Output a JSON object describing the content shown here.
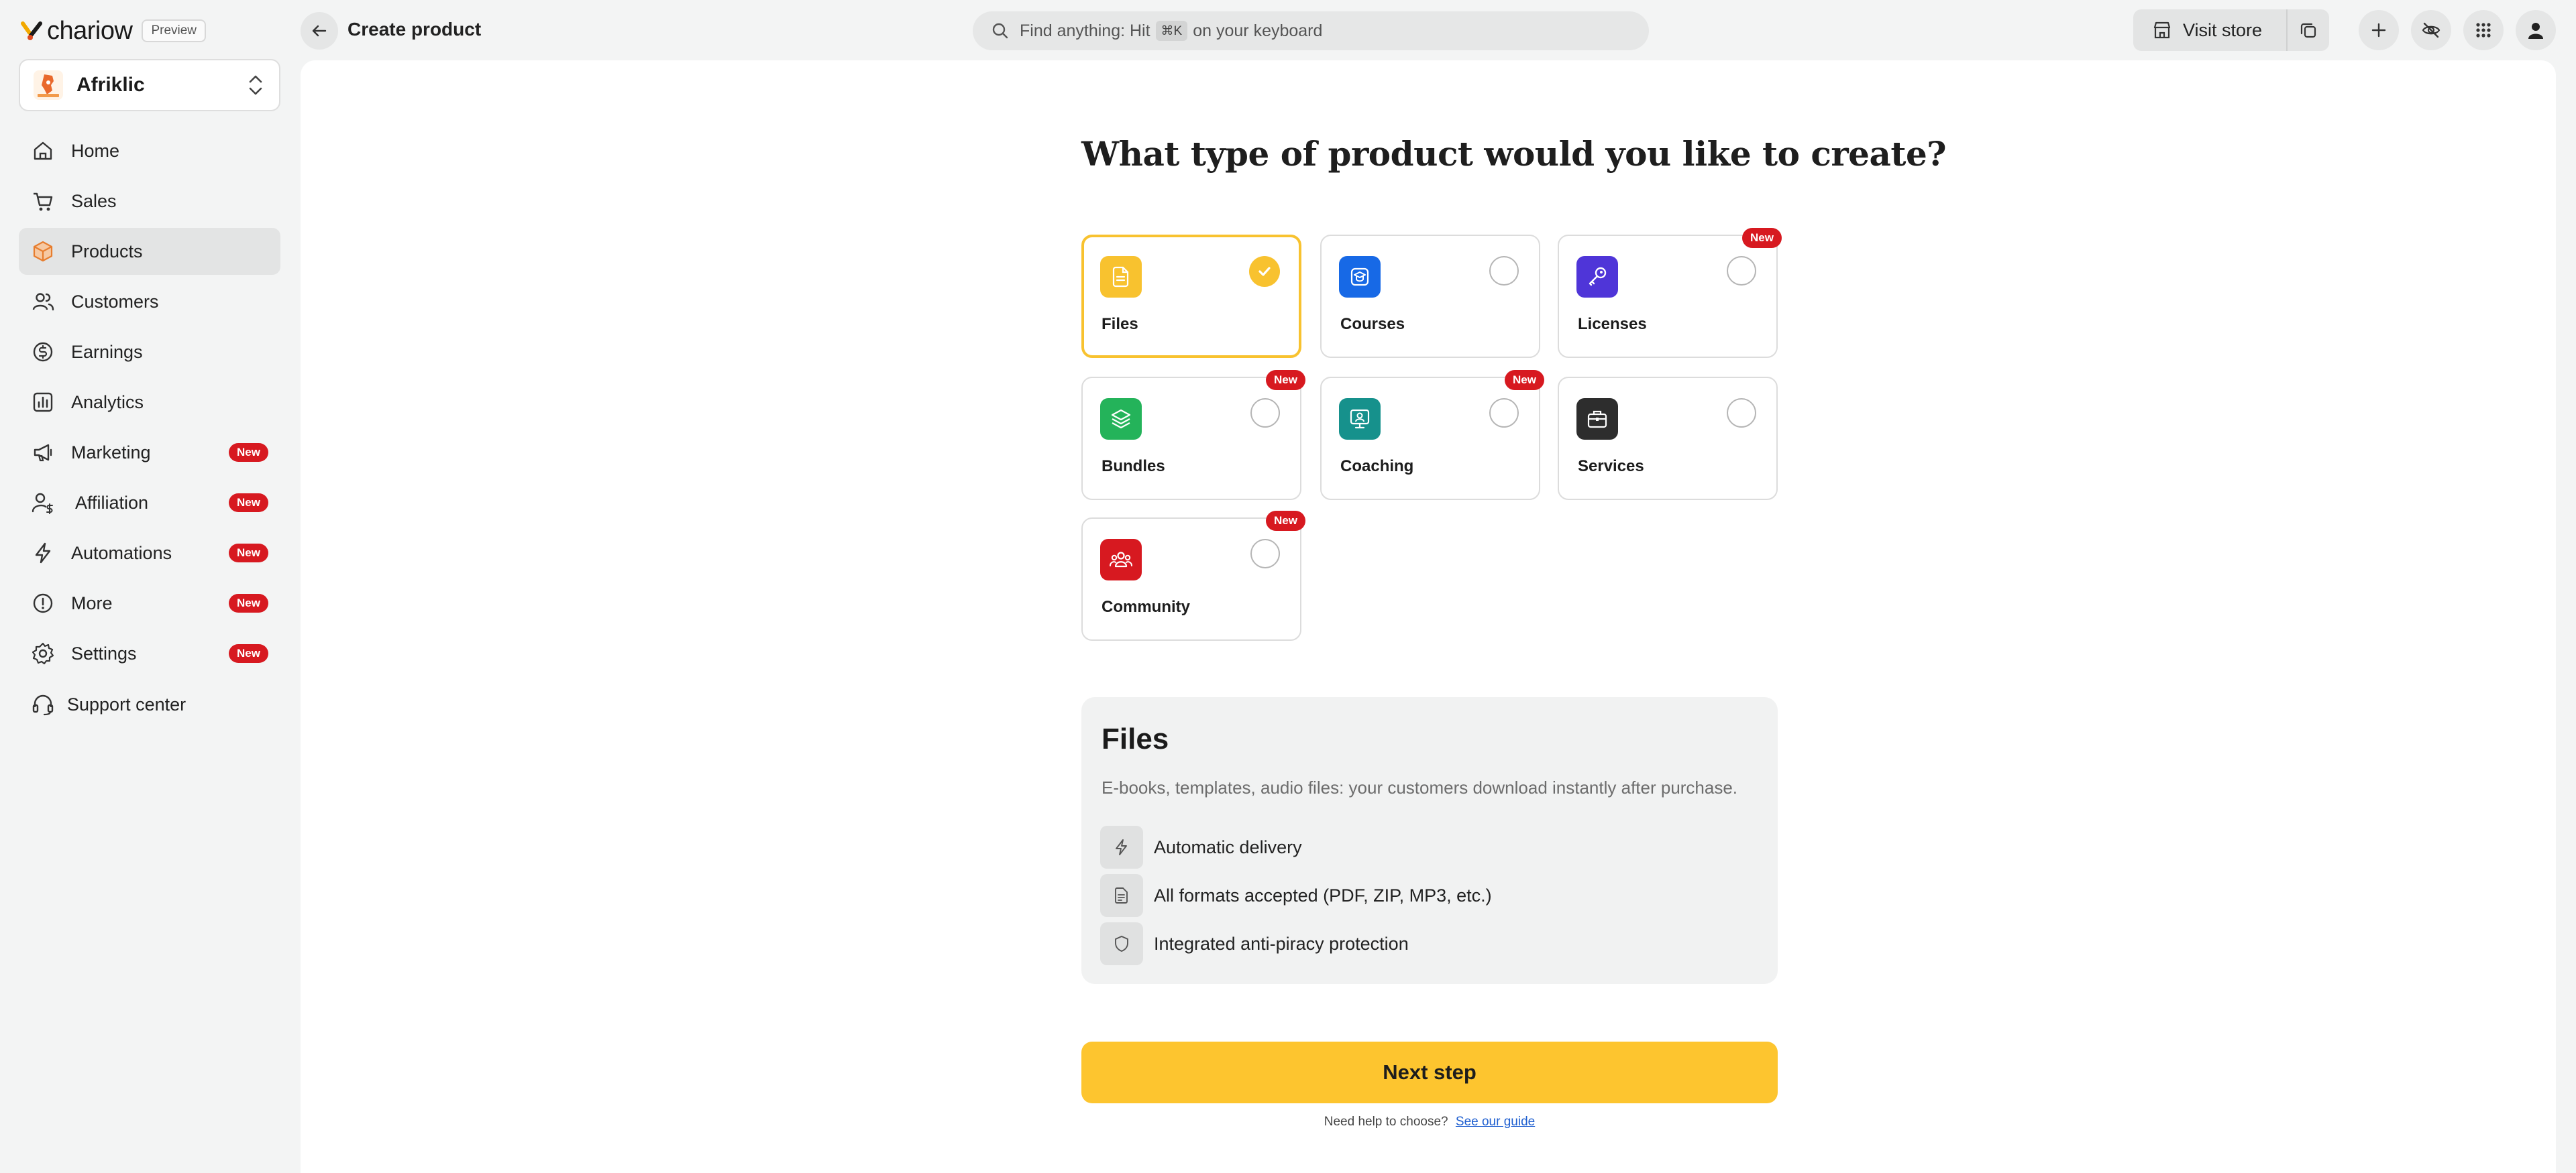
{
  "brand": {
    "name": "chariow",
    "preview_label": "Preview",
    "accent": "#fdc52f"
  },
  "store": {
    "name": "Afriklic",
    "avatar_caption": "Afriklic"
  },
  "nav": {
    "new_badge": "New",
    "items": [
      {
        "label": "Home",
        "icon": "home-icon",
        "new": false,
        "active": false
      },
      {
        "label": "Sales",
        "icon": "cart-icon",
        "new": false,
        "active": false
      },
      {
        "label": "Products",
        "icon": "box-icon",
        "new": false,
        "active": true
      },
      {
        "label": "Customers",
        "icon": "users-icon",
        "new": false,
        "active": false
      },
      {
        "label": "Earnings",
        "icon": "coin-icon",
        "new": false,
        "active": false
      },
      {
        "label": "Analytics",
        "icon": "chart-icon",
        "new": false,
        "active": false
      },
      {
        "label": "Marketing",
        "icon": "megaphone-icon",
        "new": true,
        "active": false
      },
      {
        "label": "Affiliation",
        "icon": "user-dollar-icon",
        "new": true,
        "active": false
      },
      {
        "label": "Automations",
        "icon": "bolt-icon",
        "new": true,
        "active": false
      },
      {
        "label": "More",
        "icon": "info-icon",
        "new": true,
        "active": false
      },
      {
        "label": "Settings",
        "icon": "gear-icon",
        "new": true,
        "active": false
      }
    ],
    "support": {
      "label": "Support center",
      "icon": "headset-icon"
    }
  },
  "topbar": {
    "title": "Create product",
    "search_prefix": "Find anything: Hit",
    "search_kbd": "⌘K",
    "search_suffix": "on your keyboard",
    "visit_store": "Visit store"
  },
  "main": {
    "question": "What type of product would you like to create?",
    "new_badge": "New",
    "product_types": [
      {
        "label": "Files",
        "icon": "file-icon",
        "color": "#f8c22f",
        "selected": true,
        "new": false
      },
      {
        "label": "Courses",
        "icon": "graduation-cap-icon",
        "color": "#1769e6",
        "selected": false,
        "new": false
      },
      {
        "label": "Licenses",
        "icon": "key-icon",
        "color": "#4f35d8",
        "selected": false,
        "new": true
      },
      {
        "label": "Bundles",
        "icon": "layers-icon",
        "color": "#24b35a",
        "selected": false,
        "new": true
      },
      {
        "label": "Coaching",
        "icon": "presentation-icon",
        "color": "#16918c",
        "selected": false,
        "new": true
      },
      {
        "label": "Services",
        "icon": "briefcase-icon",
        "color": "#2d2d2d",
        "selected": false,
        "new": false
      },
      {
        "label": "Community",
        "icon": "community-icon",
        "color": "#d71920",
        "selected": false,
        "new": true
      }
    ],
    "details": {
      "title": "Files",
      "description": "E-books, templates, audio files: your customers download instantly after purchase.",
      "features": [
        {
          "text": "Automatic delivery",
          "icon": "bolt-icon"
        },
        {
          "text": "All formats accepted (PDF, ZIP, MP3, etc.)",
          "icon": "document-icon"
        },
        {
          "text": "Integrated anti-piracy protection",
          "icon": "shield-icon"
        }
      ]
    },
    "next_label": "Next step",
    "help_text": "Need help to choose?",
    "help_link": "See our guide"
  }
}
